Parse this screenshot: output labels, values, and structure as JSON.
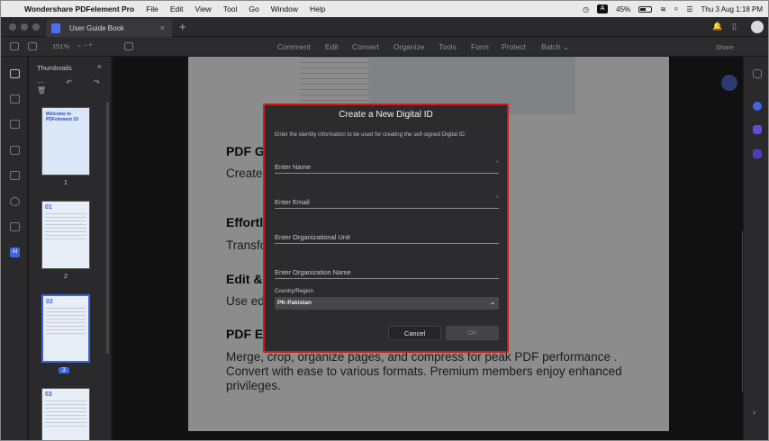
{
  "menubar": {
    "app_name": "Wondershare PDFelement Pro",
    "items": [
      "File",
      "Edit",
      "View",
      "Tool",
      "Go",
      "Window",
      "Help"
    ],
    "input_indicator": "A",
    "battery": "45%",
    "datetime": "Thu 3 Aug  1:18 PM"
  },
  "window": {
    "tab_title": "User Guide Book",
    "tab_close": "×",
    "new_tab": "+"
  },
  "toolbar": {
    "zoom": "151%",
    "zoom_controls": "⌄  –  +",
    "tools": [
      "Comment",
      "Edit",
      "Convert",
      "Organize",
      "Tools",
      "Form",
      "Protect",
      "Batch ⌄"
    ],
    "share": "Share"
  },
  "thumbnails": {
    "heading": "Thumbnails",
    "close": "×",
    "tools": "⋯ ↶ ↷ 🗑",
    "pages": [
      {
        "num": "1",
        "title": "Welcome to PDFelement 10"
      },
      {
        "num": "2",
        "title": "01"
      },
      {
        "num": "3",
        "title": "02"
      },
      {
        "num": "",
        "title": "03"
      }
    ]
  },
  "document": {
    "sections": [
      {
        "heading": "PDF Go",
        "body": "Create                                                              Mall or Cloud, scan, convert                                                        board."
      },
      {
        "heading": "Effortle",
        "body": "Transfo                                                             our OCR feature."
      },
      {
        "heading": "Edit & C",
        "body": "Use edi"
      },
      {
        "heading": "PDF En",
        "body": "Merge, crop, organize pages, and compress for peak PDF performance . Convert with ease to various formats. Premium members enjoy enhanced privileges."
      }
    ]
  },
  "dialog": {
    "title": "Create a New Digital ID",
    "subtitle": "Enter the identity information to be used for creating the self-signed Digital ID.",
    "fields": {
      "name_placeholder": "Enter Name",
      "email_placeholder": "Enter Email",
      "org_unit_placeholder": "Enter Organizational Unit",
      "org_name_placeholder": "Enter Organization Name"
    },
    "required_mark": "*",
    "country_label": "Country/Region",
    "country_value": "PK-Pakistan",
    "cancel": "Cancel",
    "ok": "OK"
  },
  "colors": {
    "accent": "#3f66e0",
    "highlight_border": "#d41a1a"
  }
}
